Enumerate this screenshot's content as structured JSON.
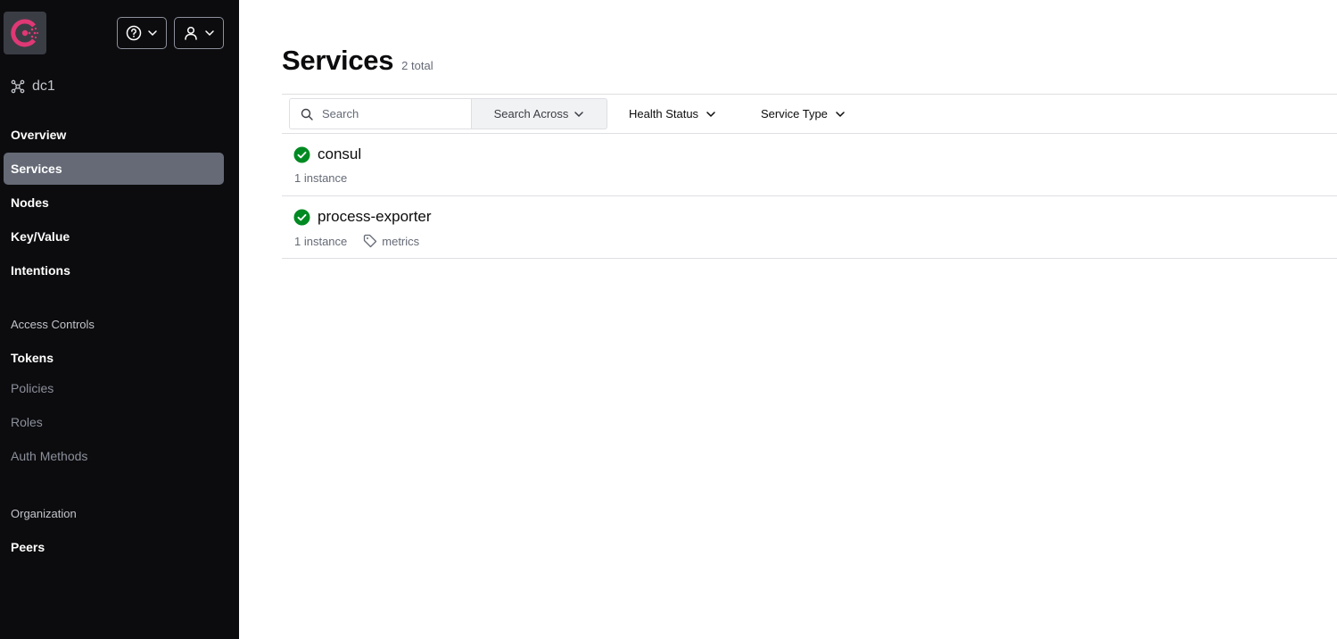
{
  "sidebar": {
    "datacenter": "dc1",
    "nav": [
      {
        "label": "Overview"
      },
      {
        "label": "Services"
      },
      {
        "label": "Nodes"
      },
      {
        "label": "Key/Value"
      },
      {
        "label": "Intentions"
      }
    ],
    "access_controls": {
      "heading": "Access Controls",
      "items": [
        {
          "label": "Tokens"
        },
        {
          "label": "Policies"
        },
        {
          "label": "Roles"
        },
        {
          "label": "Auth Methods"
        }
      ]
    },
    "organization": {
      "heading": "Organization",
      "items": [
        {
          "label": "Peers"
        }
      ]
    }
  },
  "header": {
    "title": "Services",
    "total": "2 total"
  },
  "toolbar": {
    "search_placeholder": "Search",
    "search_across": "Search Across",
    "health_status": "Health Status",
    "service_type": "Service Type"
  },
  "services": [
    {
      "name": "consul",
      "instances": "1 instance"
    },
    {
      "name": "process-exporter",
      "instances": "1 instance",
      "tag": "metrics"
    }
  ],
  "colors": {
    "sidebar_bg": "#0c0c0e",
    "active_nav": "#656a76",
    "brand": "#e03875",
    "healthy": "#008a22"
  }
}
